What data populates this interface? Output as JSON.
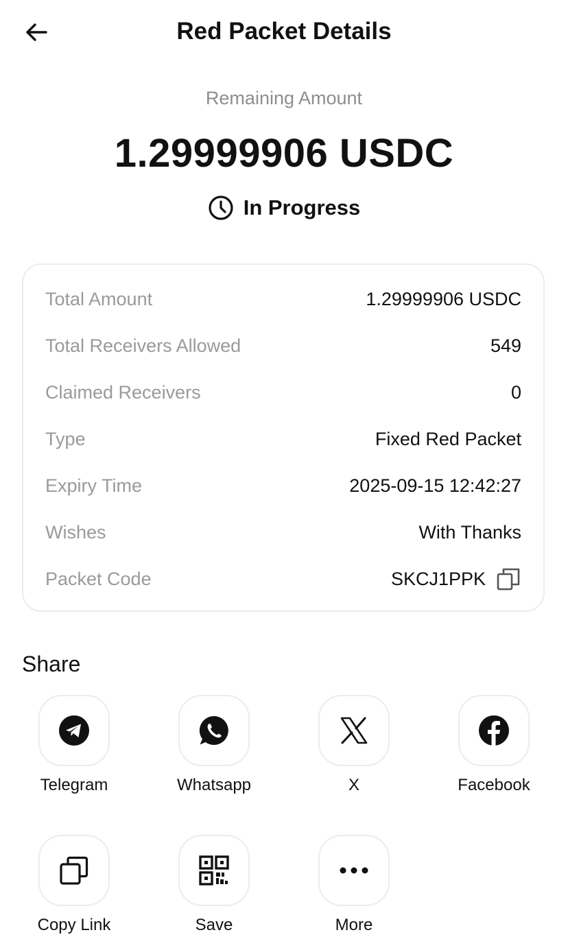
{
  "header": {
    "title": "Red Packet Details",
    "back_icon": "arrow-left-icon"
  },
  "summary": {
    "remaining_label": "Remaining Amount",
    "remaining_amount": "1.29999906 USDC",
    "status": "In Progress",
    "status_icon": "clock-icon"
  },
  "details": {
    "rows": [
      {
        "label": "Total Amount",
        "value": "1.29999906 USDC"
      },
      {
        "label": "Total Receivers Allowed",
        "value": "549"
      },
      {
        "label": "Claimed Receivers",
        "value": "0"
      },
      {
        "label": "Type",
        "value": "Fixed Red Packet"
      },
      {
        "label": "Expiry Time",
        "value": "2025-09-15 12:42:27"
      },
      {
        "label": "Wishes",
        "value": "With Thanks"
      },
      {
        "label": "Packet Code",
        "value": "SKCJ1PPK",
        "icon": "copy-icon"
      }
    ]
  },
  "share": {
    "title": "Share",
    "items": [
      {
        "label": "Telegram",
        "icon": "telegram-icon"
      },
      {
        "label": "Whatsapp",
        "icon": "whatsapp-icon"
      },
      {
        "label": "X",
        "icon": "x-icon"
      },
      {
        "label": "Facebook",
        "icon": "facebook-icon"
      },
      {
        "label": "Copy Link",
        "icon": "copy-link-icon"
      },
      {
        "label": "Save",
        "icon": "qr-code-icon"
      },
      {
        "label": "More",
        "icon": "more-icon"
      }
    ]
  }
}
